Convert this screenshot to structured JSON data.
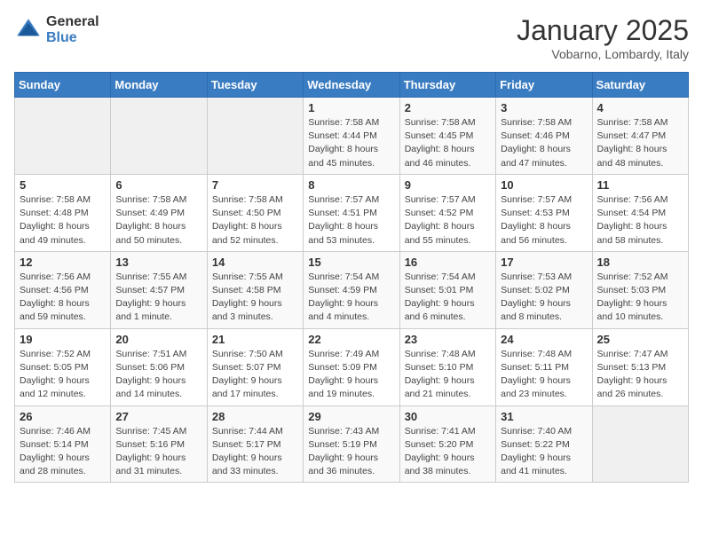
{
  "logo": {
    "general": "General",
    "blue": "Blue"
  },
  "header": {
    "month": "January 2025",
    "location": "Vobarno, Lombardy, Italy"
  },
  "days_of_week": [
    "Sunday",
    "Monday",
    "Tuesday",
    "Wednesday",
    "Thursday",
    "Friday",
    "Saturday"
  ],
  "weeks": [
    [
      {
        "day": "",
        "info": ""
      },
      {
        "day": "",
        "info": ""
      },
      {
        "day": "",
        "info": ""
      },
      {
        "day": "1",
        "info": "Sunrise: 7:58 AM\nSunset: 4:44 PM\nDaylight: 8 hours\nand 45 minutes."
      },
      {
        "day": "2",
        "info": "Sunrise: 7:58 AM\nSunset: 4:45 PM\nDaylight: 8 hours\nand 46 minutes."
      },
      {
        "day": "3",
        "info": "Sunrise: 7:58 AM\nSunset: 4:46 PM\nDaylight: 8 hours\nand 47 minutes."
      },
      {
        "day": "4",
        "info": "Sunrise: 7:58 AM\nSunset: 4:47 PM\nDaylight: 8 hours\nand 48 minutes."
      }
    ],
    [
      {
        "day": "5",
        "info": "Sunrise: 7:58 AM\nSunset: 4:48 PM\nDaylight: 8 hours\nand 49 minutes."
      },
      {
        "day": "6",
        "info": "Sunrise: 7:58 AM\nSunset: 4:49 PM\nDaylight: 8 hours\nand 50 minutes."
      },
      {
        "day": "7",
        "info": "Sunrise: 7:58 AM\nSunset: 4:50 PM\nDaylight: 8 hours\nand 52 minutes."
      },
      {
        "day": "8",
        "info": "Sunrise: 7:57 AM\nSunset: 4:51 PM\nDaylight: 8 hours\nand 53 minutes."
      },
      {
        "day": "9",
        "info": "Sunrise: 7:57 AM\nSunset: 4:52 PM\nDaylight: 8 hours\nand 55 minutes."
      },
      {
        "day": "10",
        "info": "Sunrise: 7:57 AM\nSunset: 4:53 PM\nDaylight: 8 hours\nand 56 minutes."
      },
      {
        "day": "11",
        "info": "Sunrise: 7:56 AM\nSunset: 4:54 PM\nDaylight: 8 hours\nand 58 minutes."
      }
    ],
    [
      {
        "day": "12",
        "info": "Sunrise: 7:56 AM\nSunset: 4:56 PM\nDaylight: 8 hours\nand 59 minutes."
      },
      {
        "day": "13",
        "info": "Sunrise: 7:55 AM\nSunset: 4:57 PM\nDaylight: 9 hours\nand 1 minute."
      },
      {
        "day": "14",
        "info": "Sunrise: 7:55 AM\nSunset: 4:58 PM\nDaylight: 9 hours\nand 3 minutes."
      },
      {
        "day": "15",
        "info": "Sunrise: 7:54 AM\nSunset: 4:59 PM\nDaylight: 9 hours\nand 4 minutes."
      },
      {
        "day": "16",
        "info": "Sunrise: 7:54 AM\nSunset: 5:01 PM\nDaylight: 9 hours\nand 6 minutes."
      },
      {
        "day": "17",
        "info": "Sunrise: 7:53 AM\nSunset: 5:02 PM\nDaylight: 9 hours\nand 8 minutes."
      },
      {
        "day": "18",
        "info": "Sunrise: 7:52 AM\nSunset: 5:03 PM\nDaylight: 9 hours\nand 10 minutes."
      }
    ],
    [
      {
        "day": "19",
        "info": "Sunrise: 7:52 AM\nSunset: 5:05 PM\nDaylight: 9 hours\nand 12 minutes."
      },
      {
        "day": "20",
        "info": "Sunrise: 7:51 AM\nSunset: 5:06 PM\nDaylight: 9 hours\nand 14 minutes."
      },
      {
        "day": "21",
        "info": "Sunrise: 7:50 AM\nSunset: 5:07 PM\nDaylight: 9 hours\nand 17 minutes."
      },
      {
        "day": "22",
        "info": "Sunrise: 7:49 AM\nSunset: 5:09 PM\nDaylight: 9 hours\nand 19 minutes."
      },
      {
        "day": "23",
        "info": "Sunrise: 7:48 AM\nSunset: 5:10 PM\nDaylight: 9 hours\nand 21 minutes."
      },
      {
        "day": "24",
        "info": "Sunrise: 7:48 AM\nSunset: 5:11 PM\nDaylight: 9 hours\nand 23 minutes."
      },
      {
        "day": "25",
        "info": "Sunrise: 7:47 AM\nSunset: 5:13 PM\nDaylight: 9 hours\nand 26 minutes."
      }
    ],
    [
      {
        "day": "26",
        "info": "Sunrise: 7:46 AM\nSunset: 5:14 PM\nDaylight: 9 hours\nand 28 minutes."
      },
      {
        "day": "27",
        "info": "Sunrise: 7:45 AM\nSunset: 5:16 PM\nDaylight: 9 hours\nand 31 minutes."
      },
      {
        "day": "28",
        "info": "Sunrise: 7:44 AM\nSunset: 5:17 PM\nDaylight: 9 hours\nand 33 minutes."
      },
      {
        "day": "29",
        "info": "Sunrise: 7:43 AM\nSunset: 5:19 PM\nDaylight: 9 hours\nand 36 minutes."
      },
      {
        "day": "30",
        "info": "Sunrise: 7:41 AM\nSunset: 5:20 PM\nDaylight: 9 hours\nand 38 minutes."
      },
      {
        "day": "31",
        "info": "Sunrise: 7:40 AM\nSunset: 5:22 PM\nDaylight: 9 hours\nand 41 minutes."
      },
      {
        "day": "",
        "info": ""
      }
    ]
  ]
}
